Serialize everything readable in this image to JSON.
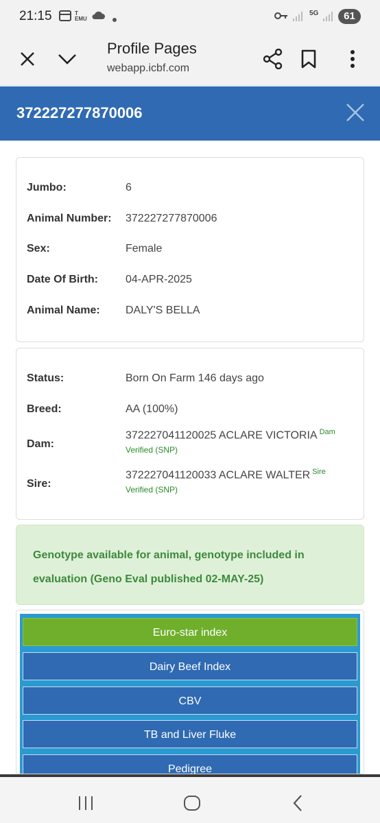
{
  "status_bar": {
    "time": "21:15",
    "network": "5G",
    "battery": "61"
  },
  "browser": {
    "title": "Profile Pages",
    "url": "webapp.icbf.com"
  },
  "header": {
    "animal_id": "372227277870006"
  },
  "identity": {
    "rows": [
      {
        "label": "Jumbo:",
        "value": "6"
      },
      {
        "label": "Animal Number:",
        "value": "372227277870006"
      },
      {
        "label": "Sex:",
        "value": "Female"
      },
      {
        "label": "Date Of Birth:",
        "value": "04-APR-2025"
      },
      {
        "label": "Animal Name:",
        "value": "DALY'S BELLA"
      }
    ]
  },
  "lineage": {
    "status_label": "Status:",
    "status_value": "Born On Farm 146 days ago",
    "breed_label": "Breed:",
    "breed_value": "AA (100%)",
    "dam_label": "Dam:",
    "dam_value": "372227041120025 ACLARE VICTORIA",
    "dam_tag": "Dam",
    "dam_verified": "Verified (SNP)",
    "sire_label": "Sire:",
    "sire_value": "372227041120033 ACLARE WALTER",
    "sire_tag": "Sire",
    "sire_verified": "Verified (SNP)"
  },
  "genotype": {
    "message": "Genotype available for animal, genotype included in evaluation (Geno Eval published 02-MAY-25)"
  },
  "menu": {
    "items": [
      "Euro-star index",
      "Dairy Beef Index",
      "CBV",
      "TB and Liver Fluke",
      "Pedigree"
    ]
  },
  "colors": {
    "header_blue": "#2f6ab3",
    "active_green": "#6faf2b",
    "genotype_bg": "#dff0d8"
  }
}
